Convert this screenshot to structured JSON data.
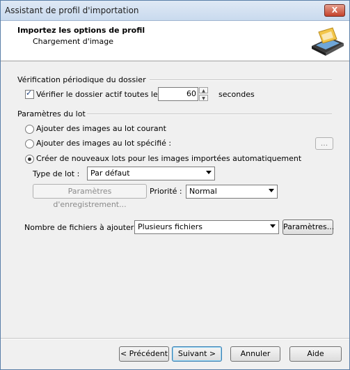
{
  "window": {
    "title": "Assistant de profil d'importation",
    "close_label": "X"
  },
  "header": {
    "title": "Importez les options de profil",
    "subtitle": "Chargement d'image",
    "icon": "scanner-icon"
  },
  "folder_check": {
    "group_label": "Vérification périodique du dossier",
    "checkbox_label": "Vérifier le dossier actif toutes les",
    "checked": true,
    "interval_value": "60",
    "unit_label": "secondes"
  },
  "batch": {
    "group_label": "Paramètres du lot",
    "options": [
      {
        "label": "Ajouter des images au lot courant",
        "selected": false
      },
      {
        "label": "Ajouter des images au lot spécifié :",
        "selected": false
      },
      {
        "label": "Créer de nouveaux lots pour les images importées automatiquement",
        "selected": true
      }
    ],
    "browse_label": "...",
    "type_label": "Type de lot :",
    "type_value": "Par défaut",
    "save_params_label": "Paramètres d'enregistrement...",
    "priority_label": "Priorité :",
    "priority_value": "Normal"
  },
  "files": {
    "label": "Nombre de fichiers à ajouter :",
    "value": "Plusieurs fichiers",
    "params_button": "Paramètres..."
  },
  "footer": {
    "prev": "< Précédent",
    "next": "Suivant >",
    "cancel": "Annuler",
    "help": "Aide"
  }
}
